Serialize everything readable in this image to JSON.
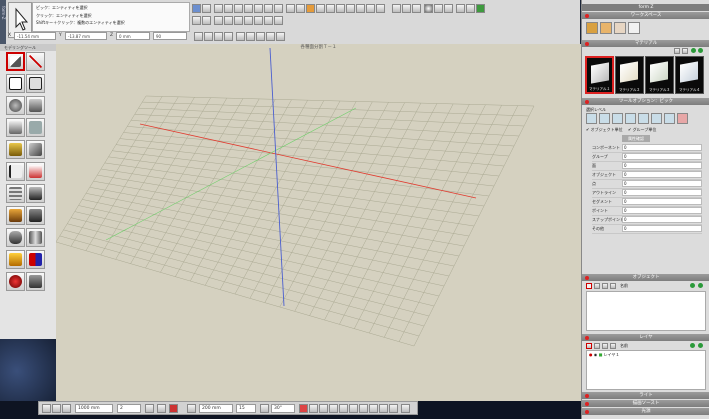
{
  "app": {
    "left_strip_label": "form-Z"
  },
  "hint": {
    "line1": "ピック：エンティティを選択",
    "line2": "クリック：エンティティを選択",
    "line3": "Shiftキー＋クリック：複数のエンティティを選択"
  },
  "coords": {
    "x_label": "X",
    "x_value": "-11.54 mm",
    "y_label": "Y",
    "y_value": "-13.87 mm",
    "z_label": "Z",
    "z_value": "0 mm",
    "extra_value": "90"
  },
  "tool_panel": {
    "header": "モデリングツール"
  },
  "viewport": {
    "title": "各種面分割Ｔ－１"
  },
  "bottombar": {
    "grid_value": "1000 mm",
    "grid_count": "2",
    "snap_value": "200 mm",
    "angle_value": "15",
    "extra": "30°"
  },
  "right_panel": {
    "window_title": "form Z",
    "workspace_header": "ワークスペース",
    "materials_header": "マテリアル",
    "materials": [
      "マテリアル１",
      "マテリアル２",
      "マテリアル３",
      "マテリアル４"
    ],
    "tool_options_header": "ツールオプション：ピック",
    "pick_label": "選択レベル",
    "check1": "オブジェクト単位",
    "check2": "グループ単位",
    "props_button": "属性確認",
    "props": [
      {
        "label": "コンポーネント",
        "value": "0"
      },
      {
        "label": "グループ",
        "value": "0"
      },
      {
        "label": "面",
        "value": "0"
      },
      {
        "label": "オブジェクト",
        "value": "0"
      },
      {
        "label": "点",
        "value": "0"
      },
      {
        "label": "アウトライン",
        "value": "0"
      },
      {
        "label": "セグメント",
        "value": "0"
      },
      {
        "label": "ポイント",
        "value": "0"
      },
      {
        "label": "スナップポイント",
        "value": "0"
      },
      {
        "label": "その他",
        "value": "0"
      }
    ],
    "objects_header": "オブジェクト",
    "objects_col": "名前",
    "layers_header": "レイヤ",
    "layers_col": "名前",
    "layer1": "レイヤ１",
    "lights_header": "ライト",
    "display_header": "描画ソースト",
    "status_header": "光源"
  },
  "colors": {
    "x_axis": "#e03b2f",
    "y_axis": "#6fd06a",
    "z_axis": "#4b5fcf",
    "grid": "#aaa992",
    "viewport_bg": "#d5d1c0"
  }
}
